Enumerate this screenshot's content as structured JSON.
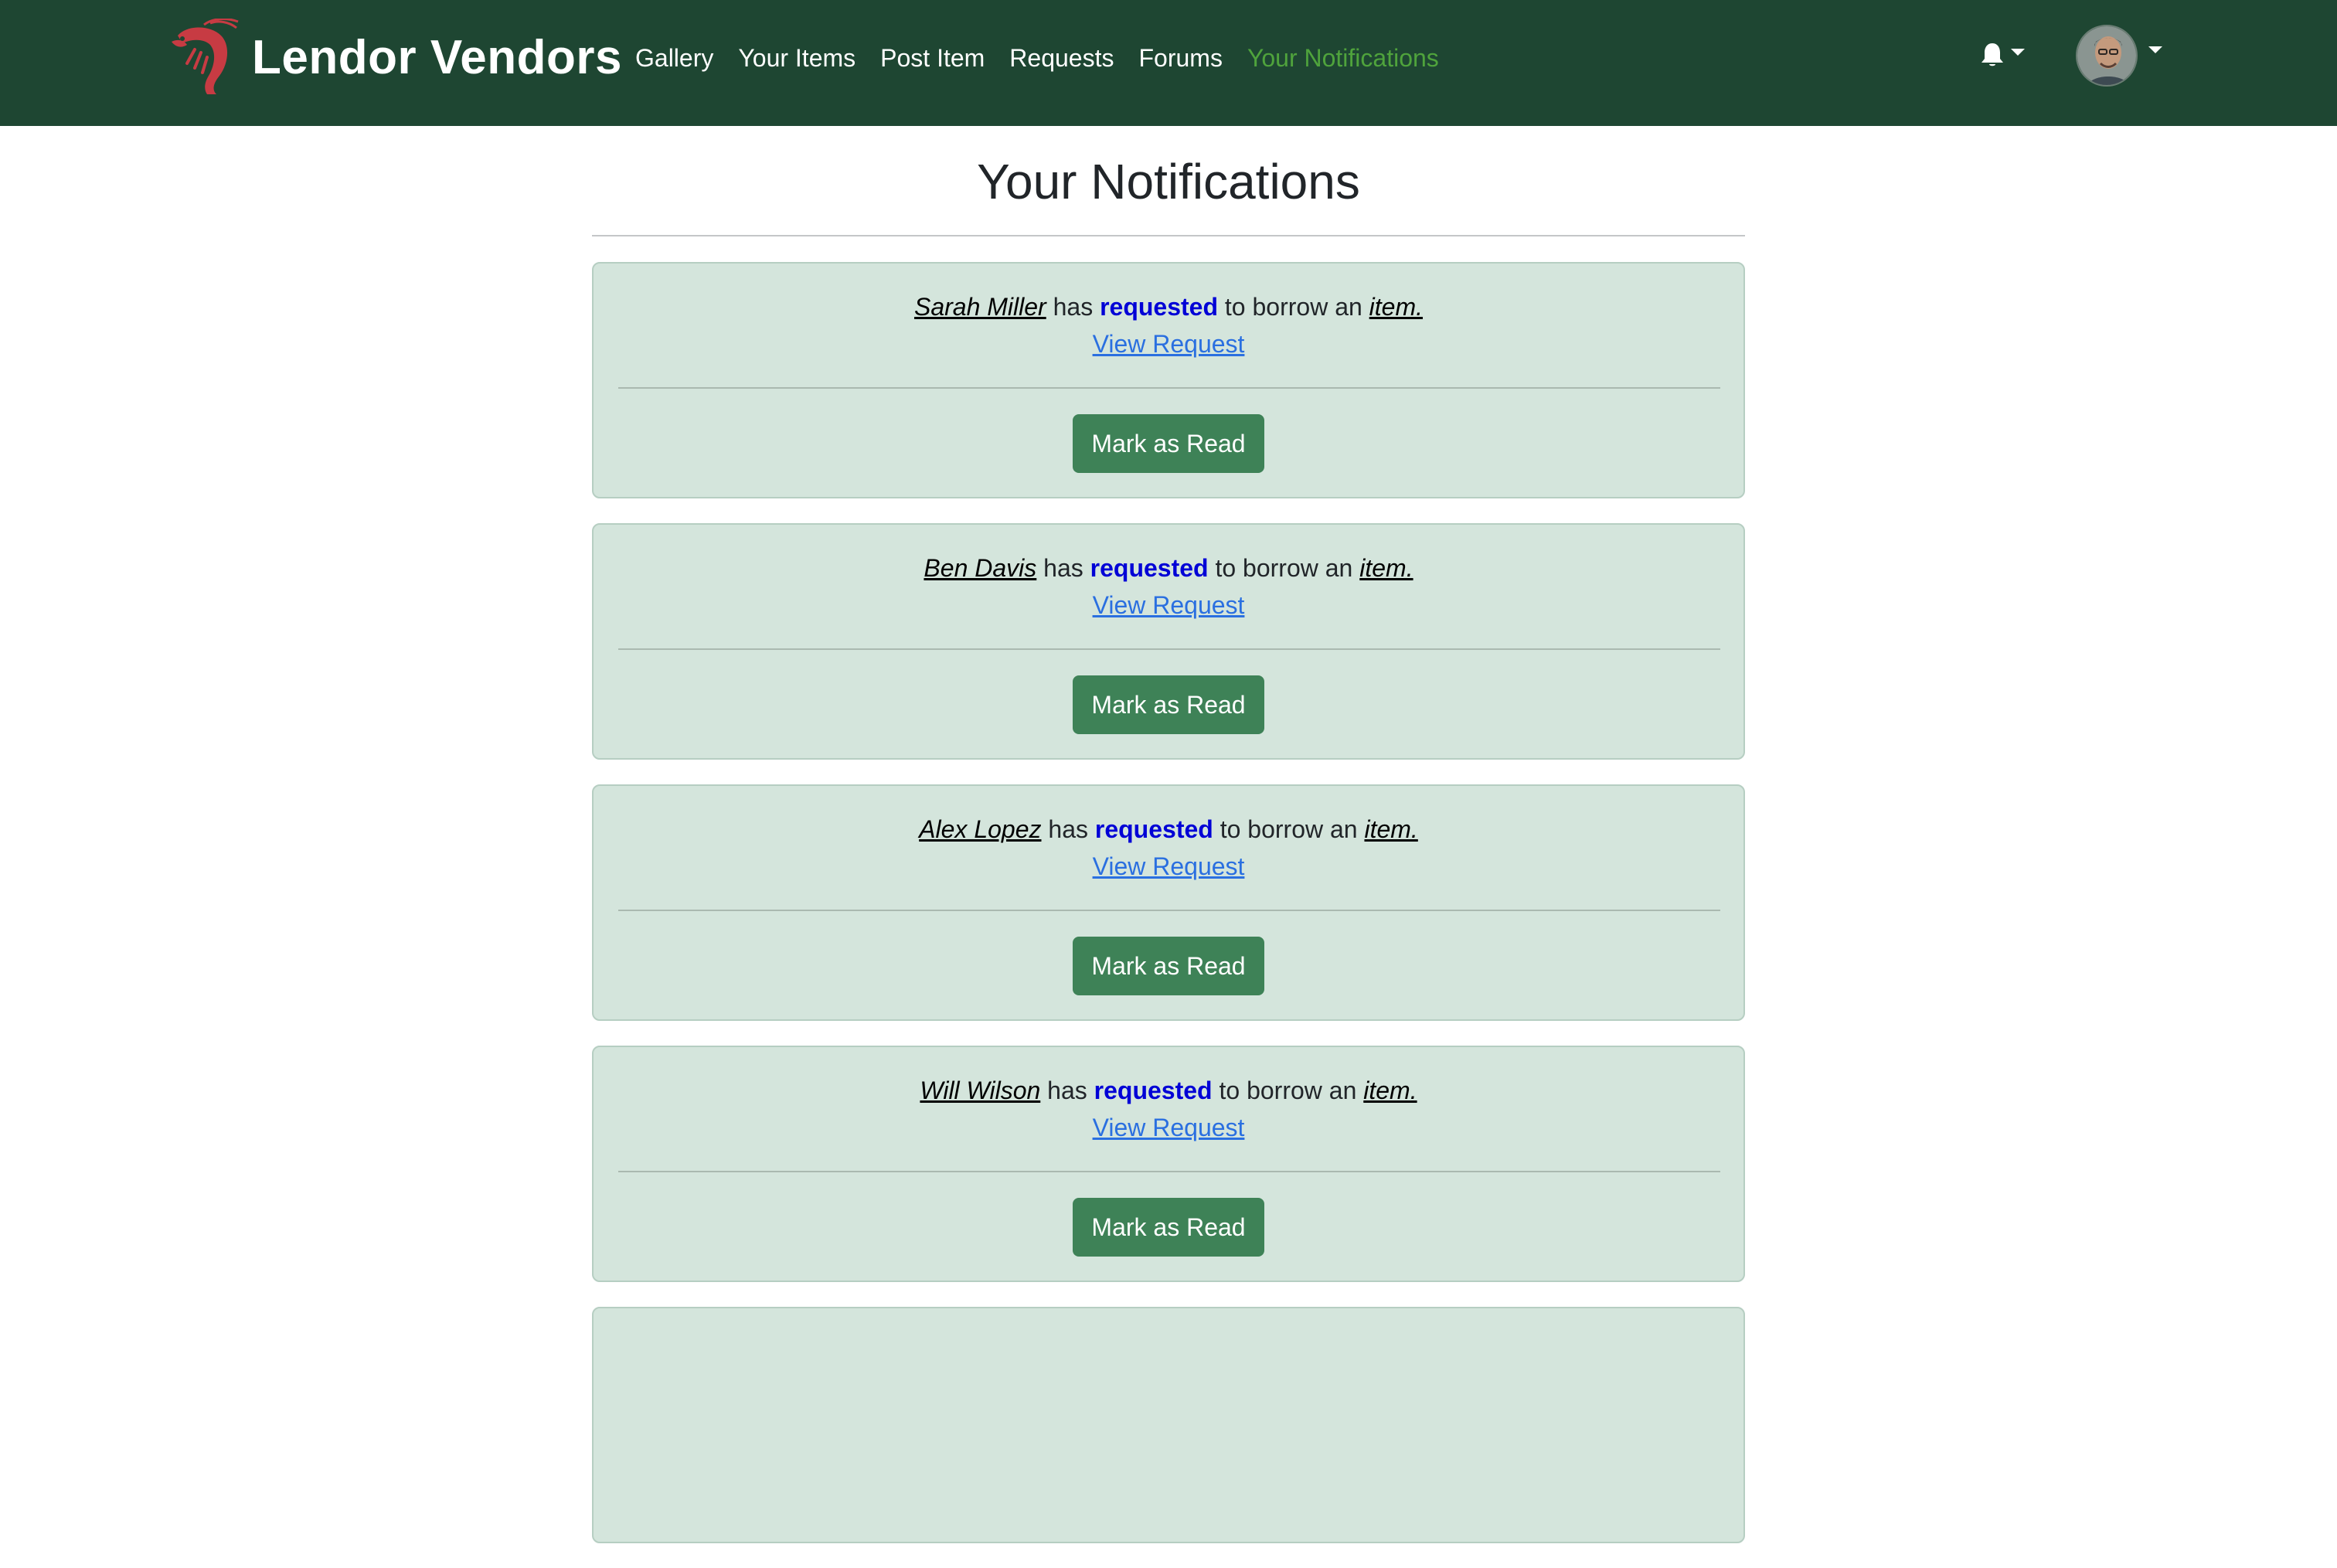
{
  "navbar": {
    "brand": "Lendor Vendors",
    "links": [
      {
        "label": "Gallery"
      },
      {
        "label": "Your Items"
      },
      {
        "label": "Post Item"
      },
      {
        "label": "Requests"
      },
      {
        "label": "Forums"
      },
      {
        "label": "Your Notifications",
        "active": true
      }
    ],
    "icons": {
      "logo": "shrimp-logo",
      "bell": "bell-icon",
      "avatar": "user-avatar"
    },
    "colors": {
      "background": "#1e4632",
      "active_link": "#4fa33c"
    }
  },
  "page": {
    "title": "Your Notifications"
  },
  "notifications": [
    {
      "name": "Sarah Miller",
      "text_has": "has",
      "verb": "requested",
      "text_mid": "to borrow an",
      "item": "item.",
      "link": "View Request",
      "button": "Mark as Read"
    },
    {
      "name": "Ben Davis",
      "text_has": "has",
      "verb": "requested",
      "text_mid": "to borrow an",
      "item": "item.",
      "link": "View Request",
      "button": "Mark as Read"
    },
    {
      "name": "Alex Lopez",
      "text_has": "has",
      "verb": "requested",
      "text_mid": "to borrow an",
      "item": "item.",
      "link": "View Request",
      "button": "Mark as Read"
    },
    {
      "name": "Will Wilson",
      "text_has": "has",
      "verb": "requested",
      "text_mid": "to borrow an",
      "item": "item.",
      "link": "View Request",
      "button": "Mark as Read"
    }
  ],
  "colors": {
    "card_bg": "#d4e5dc",
    "button_bg": "#3e8257",
    "verb": "#0000d6",
    "link": "#2a6fe0"
  }
}
